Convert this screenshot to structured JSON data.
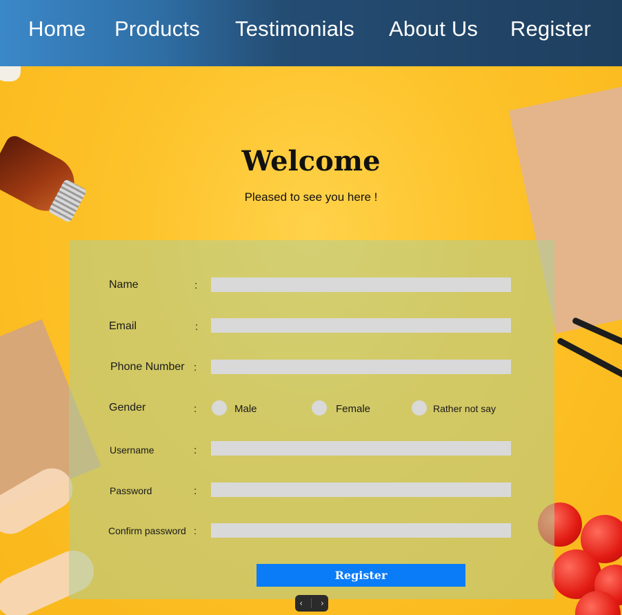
{
  "nav": {
    "items": [
      {
        "label": "Home"
      },
      {
        "label": "Products"
      },
      {
        "label": "Testimonials"
      },
      {
        "label": "About Us"
      },
      {
        "label": "Register"
      }
    ]
  },
  "welcome": {
    "title": "Welcome",
    "subtitle": "Pleased to see you here !"
  },
  "form": {
    "name_label": "Name",
    "email_label": "Email",
    "phone_label": "Phone Number",
    "gender_label": "Gender",
    "username_label": "Username",
    "password_label": "Password",
    "confirm_label": "Confirm password",
    "colon": ":",
    "gender_options": [
      {
        "label": "Male"
      },
      {
        "label": "Female"
      },
      {
        "label": "Rather not say"
      }
    ],
    "values": {
      "name": "",
      "email": "",
      "phone": "",
      "username": "",
      "password": "",
      "confirm": ""
    },
    "submit_label": "Register"
  },
  "pager": {
    "prev": "‹",
    "next": "›"
  },
  "colors": {
    "nav_start": "#3b88c8",
    "nav_end": "#1f3f5e",
    "background": "#fbbf1f",
    "field": "#d9d9d9",
    "button": "#0a7cf8"
  }
}
